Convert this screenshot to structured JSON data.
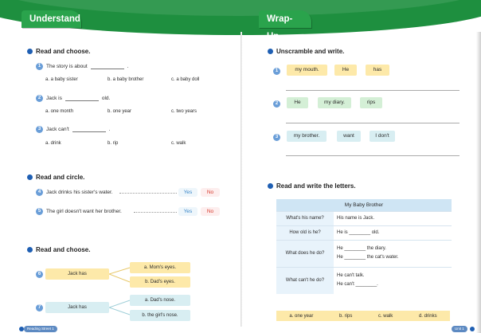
{
  "left_tab": "Understand",
  "right_tab": "Wrap-Up",
  "left": {
    "sec1_title": "Read and choose.",
    "q1": {
      "num": "1",
      "text": "The story is about",
      "end": ".",
      "opts": [
        "a. a baby sister",
        "b. a baby brother",
        "c. a baby doll"
      ]
    },
    "q2": {
      "num": "2",
      "text": "Jack is",
      "end": "old.",
      "opts": [
        "a. one month",
        "b. one year",
        "c. two years"
      ]
    },
    "q3": {
      "num": "3",
      "text": "Jack can't",
      "end": ".",
      "opts": [
        "a. drink",
        "b. rip",
        "c. walk"
      ]
    },
    "sec2_title": "Read and circle.",
    "c4": {
      "num": "4",
      "text": "Jack drinks his sister's water.",
      "yes": "Yes",
      "no": "No"
    },
    "c5": {
      "num": "5",
      "text": "The girl doesn't want her brother.",
      "yes": "Yes",
      "no": "No"
    },
    "sec3_title": "Read and choose.",
    "m6": {
      "num": "6",
      "subject": "Jack has",
      "a": "a. Mom's eyes.",
      "b": "b. Dad's eyes."
    },
    "m7": {
      "num": "7",
      "subject": "Jack has",
      "a": "a. Dad's nose.",
      "b": "b. the girl's nose."
    },
    "footer": "Reading Street 1"
  },
  "right": {
    "sec1_title": "Unscramble and write.",
    "u1": {
      "num": "1",
      "chips": [
        "my mouth.",
        "He",
        "has"
      ]
    },
    "u2": {
      "num": "2",
      "chips": [
        "He",
        "my diary.",
        "rips"
      ]
    },
    "u3": {
      "num": "3",
      "chips": [
        "my brother.",
        "want",
        "I don't"
      ]
    },
    "sec2_title": "Read and write the letters.",
    "table": {
      "header": "My Baby Brother",
      "rows": [
        {
          "q": "What's his name?",
          "a1": "His name is Jack.",
          "a2": ""
        },
        {
          "q": "How old is he?",
          "a1": "He is ________ old.",
          "a2": ""
        },
        {
          "q": "What does he do?",
          "a1": "He ________ the diary.",
          "a2": "He ________ the cat's water."
        },
        {
          "q": "What can't he do?",
          "a1": "He can't talk.",
          "a2": "He can't ________."
        }
      ]
    },
    "letters": [
      "a. one year",
      "b. rips",
      "c. walk",
      "d. drinks"
    ],
    "footer": "Unit 1"
  }
}
